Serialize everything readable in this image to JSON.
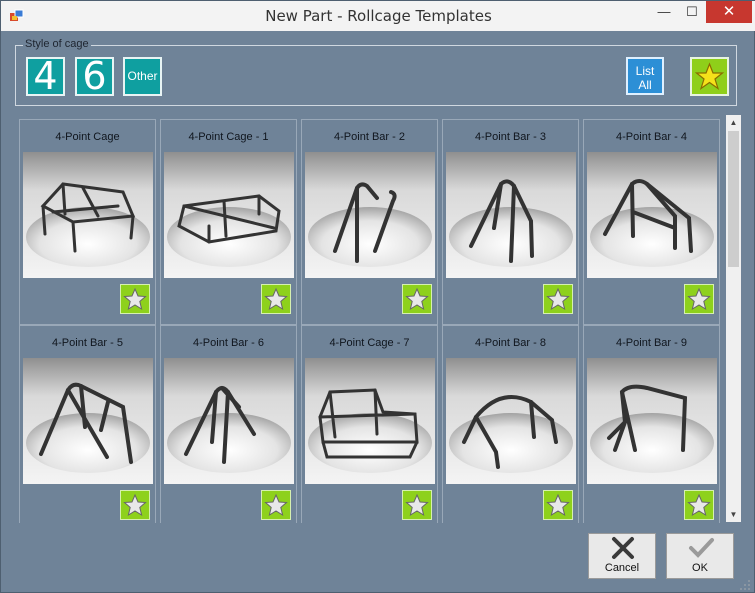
{
  "window": {
    "title": "New Part - Rollcage Templates",
    "close_glyph": "✕",
    "min_glyph": "—",
    "max_glyph": "☐"
  },
  "style_group": {
    "label": "Style of cage",
    "buttons": [
      "4",
      "6",
      "Other"
    ],
    "list_all_line1": "List",
    "list_all_line2": "All"
  },
  "templates": [
    {
      "name": "4-Point Cage",
      "shape": "cage-a"
    },
    {
      "name": "4-Point Cage - 1",
      "shape": "cage-b"
    },
    {
      "name": "4-Point Bar - 2",
      "shape": "bar-2"
    },
    {
      "name": "4-Point Bar - 3",
      "shape": "bar-3"
    },
    {
      "name": "4-Point Bar - 4",
      "shape": "bar-4"
    },
    {
      "name": "4-Point Bar - 5",
      "shape": "bar-5"
    },
    {
      "name": "4-Point Bar - 6",
      "shape": "bar-6"
    },
    {
      "name": "4-Point Cage - 7",
      "shape": "cage-7"
    },
    {
      "name": "4-Point Bar - 8",
      "shape": "bar-8"
    },
    {
      "name": "4-Point Bar - 9",
      "shape": "bar-9"
    }
  ],
  "actions": {
    "cancel": "Cancel",
    "ok": "OK"
  },
  "colors": {
    "background": "#6f8398",
    "teal": "#0f9fa0",
    "blue": "#2c8fd6",
    "green": "#8ed11c"
  }
}
